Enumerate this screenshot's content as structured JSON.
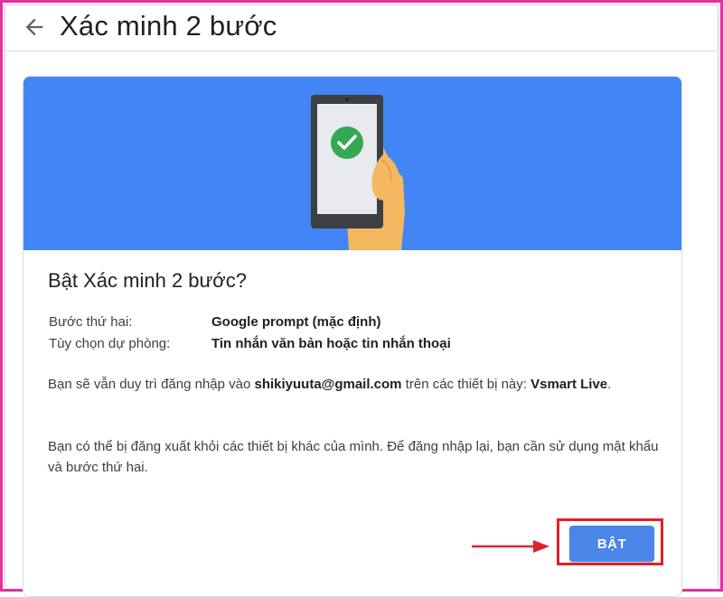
{
  "header": {
    "title": "Xác minh 2 bước",
    "back_icon": "arrow-left-icon"
  },
  "banner": {
    "color": "#4285f4",
    "illustration": "phone-check-icon"
  },
  "card": {
    "title": "Bật Xác minh 2 bước?",
    "rows": [
      {
        "label": "Bước thứ hai:",
        "value": "Google prompt (mặc định)"
      },
      {
        "label": "Tùy chọn dự phòng:",
        "value": "Tin nhắn văn bản hoặc tin nhắn thoại"
      }
    ],
    "para1": {
      "prefix": "Bạn sẽ vẫn duy trì đăng nhập vào ",
      "email": "shikiyuuta@gmail.com",
      "middle": " trên các thiết bị này: ",
      "device": "Vsmart Live",
      "suffix": "."
    },
    "para2": "Bạn có thể bị đăng xuất khỏi các thiết bị khác của mình. Để đăng nhập lại, bạn cần sử dụng mật khẩu và bước thứ hai."
  },
  "action": {
    "button_label": "BẬT",
    "button_color": "#4a86e8",
    "annotation_color": "#e0212a"
  }
}
